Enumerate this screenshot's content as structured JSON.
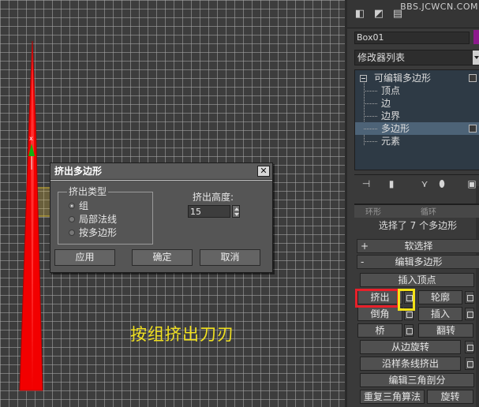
{
  "viewport": {
    "caption": "按组挤出刀刃",
    "colors": {
      "blade": "#f20000",
      "grid": "#aaaaaa",
      "axis_green": "#10b010",
      "caption": "#f0e020"
    }
  },
  "dialog": {
    "title": "挤出多边形",
    "close_icon": "close-icon",
    "group_title": "挤出类型",
    "options": [
      {
        "label": "组",
        "selected": true
      },
      {
        "label": "局部法线",
        "selected": false
      },
      {
        "label": "按多边形",
        "selected": false
      }
    ],
    "height_label": "挤出高度:",
    "height_value": "15",
    "buttons": {
      "apply": "应用",
      "ok": "确定",
      "cancel": "取消"
    }
  },
  "panel": {
    "watermark": "BBS.JCWCN.COM",
    "object_name": "Box01",
    "modifier_list": "修改器列表",
    "stack": {
      "root": "可编辑多边形",
      "items": [
        "顶点",
        "边",
        "边界",
        "多边形",
        "元素"
      ],
      "selected": "多边形"
    },
    "scroll_fragment": [
      "环形",
      "循环"
    ],
    "selection_status": "选择了 7 个多边形",
    "rollouts": {
      "soft_selection": "软选择",
      "edit_polygons": "编辑多边形",
      "soft_sign": "+",
      "edit_sign": "-"
    },
    "buttons": {
      "insert_vertex": "插入顶点",
      "extrude": "挤出",
      "outline": "轮廓",
      "bevel": "倒角",
      "inset": "插入",
      "bridge": "桥",
      "flip": "翻转",
      "hinge": "从边旋转",
      "extrude_spline": "沿样条线挤出",
      "edit_tri": "编辑三角剖分",
      "retriangulate": "重复三角算法",
      "turn": "旋转"
    },
    "highlight_colors": {
      "red": "#e8202a",
      "yellow": "#f3e116"
    }
  }
}
